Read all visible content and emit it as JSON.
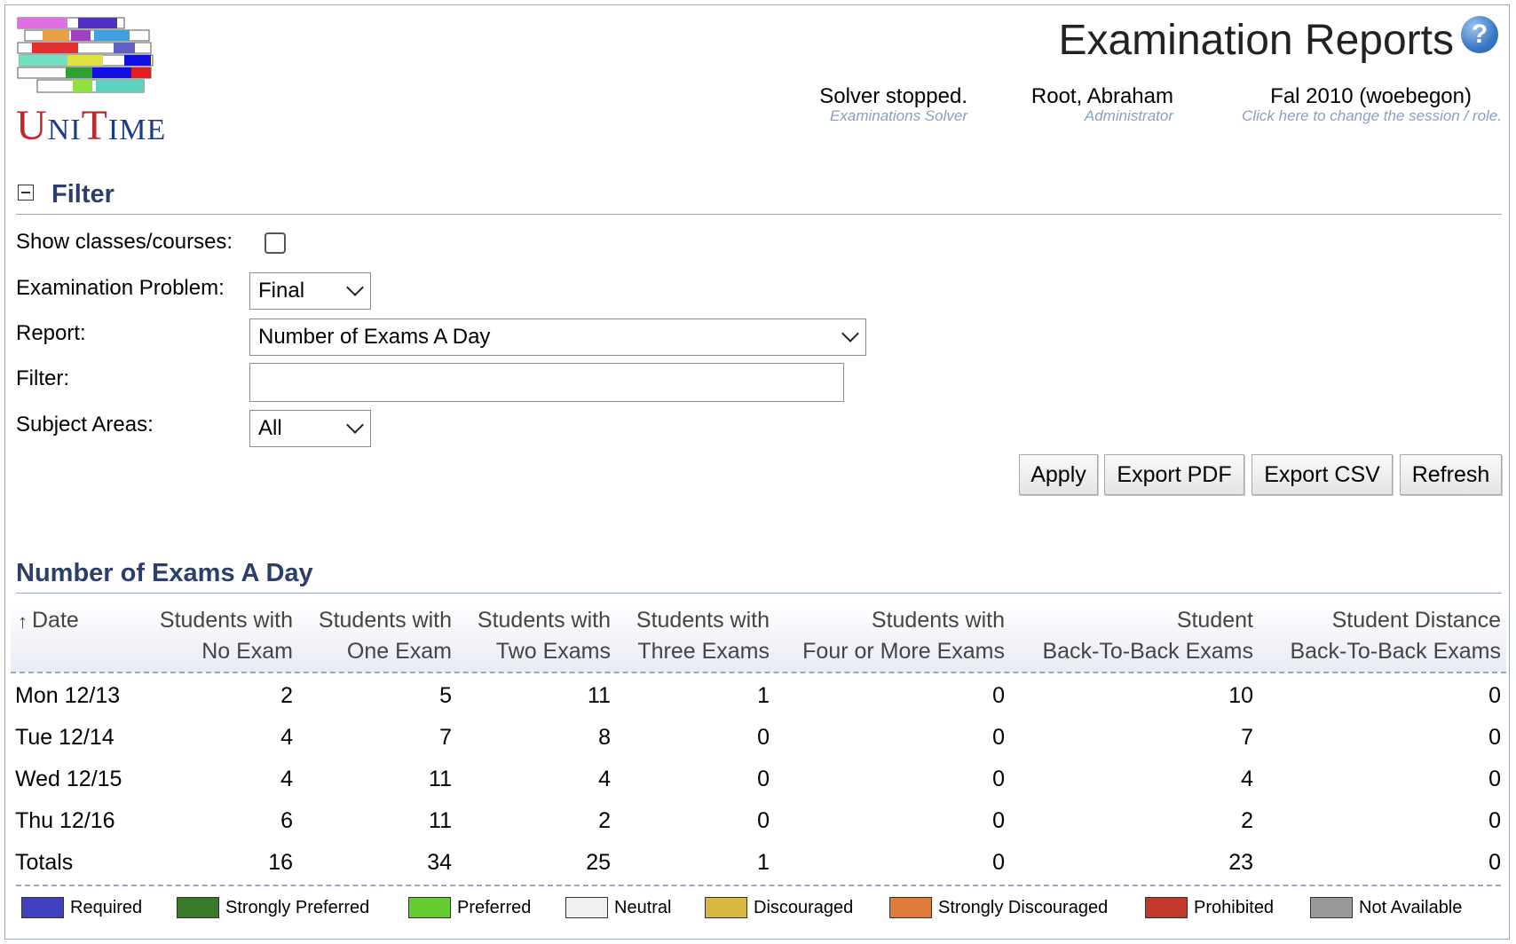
{
  "header": {
    "title": "Examination Reports",
    "help_icon": "?",
    "solver": {
      "main": "Solver stopped.",
      "sub": "Examinations Solver"
    },
    "user": {
      "main": "Root, Abraham",
      "sub": "Administrator"
    },
    "session": {
      "main": "Fal 2010 (woebegon)",
      "sub": "Click here to change the session / role."
    }
  },
  "logo": {
    "u": "U",
    "n": "NI",
    "t": "T",
    "me": "IME"
  },
  "filter": {
    "title": "Filter",
    "show_classes_label": "Show classes/courses:",
    "problem_label": "Examination Problem:",
    "problem_value": "Final",
    "report_label": "Report:",
    "report_value": "Number of Exams A Day",
    "filter_label": "Filter:",
    "filter_value": "",
    "subject_label": "Subject Areas:",
    "subject_value": "All",
    "buttons": {
      "apply": "Apply",
      "export_pdf": "Export PDF",
      "export_csv": "Export CSV",
      "refresh": "Refresh"
    }
  },
  "report": {
    "title": "Number of Exams A Day",
    "sort_icon": "↑",
    "columns": [
      {
        "l1": "Date",
        "l2": ""
      },
      {
        "l1": "Students with",
        "l2": "No Exam"
      },
      {
        "l1": "Students with",
        "l2": "One Exam"
      },
      {
        "l1": "Students with",
        "l2": "Two Exams"
      },
      {
        "l1": "Students with",
        "l2": "Three Exams"
      },
      {
        "l1": "Students with",
        "l2": "Four or More Exams"
      },
      {
        "l1": "Student",
        "l2": "Back-To-Back Exams"
      },
      {
        "l1": "Student Distance",
        "l2": "Back-To-Back Exams"
      }
    ],
    "rows": [
      [
        "Mon 12/13",
        "2",
        "5",
        "11",
        "1",
        "0",
        "10",
        "0"
      ],
      [
        "Tue 12/14",
        "4",
        "7",
        "8",
        "0",
        "0",
        "7",
        "0"
      ],
      [
        "Wed 12/15",
        "4",
        "11",
        "4",
        "0",
        "0",
        "4",
        "0"
      ],
      [
        "Thu 12/16",
        "6",
        "11",
        "2",
        "0",
        "0",
        "2",
        "0"
      ],
      [
        "Totals",
        "16",
        "34",
        "25",
        "1",
        "0",
        "23",
        "0"
      ]
    ]
  },
  "legend": [
    {
      "label": "Required",
      "color": "#4040c0"
    },
    {
      "label": "Strongly Preferred",
      "color": "#3a7a2a"
    },
    {
      "label": "Preferred",
      "color": "#66cc33"
    },
    {
      "label": "Neutral",
      "color": "#f0f0f0"
    },
    {
      "label": "Discouraged",
      "color": "#d8b840"
    },
    {
      "label": "Strongly Discouraged",
      "color": "#e07a3a"
    },
    {
      "label": "Prohibited",
      "color": "#c0392b"
    },
    {
      "label": "Not Available",
      "color": "#999999"
    }
  ]
}
